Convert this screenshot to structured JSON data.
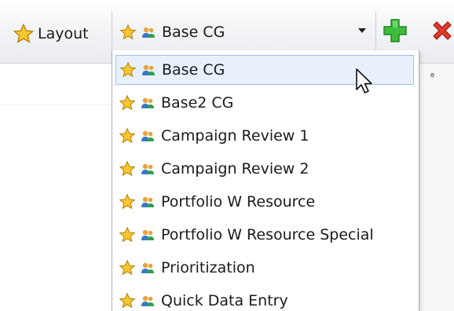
{
  "toolbar": {
    "layout_label": "Layout",
    "current_layout": "Base CG",
    "icons": {
      "layout": "star-icon",
      "add": "green-plus-icon",
      "remove": "red-x-icon"
    }
  },
  "dropdown": {
    "items": [
      {
        "label": "Base CG",
        "selected": true
      },
      {
        "label": "Base2 CG"
      },
      {
        "label": "Campaign Review 1"
      },
      {
        "label": "Campaign Review 2"
      },
      {
        "label": "Portfolio W Resource"
      },
      {
        "label": "Portfolio W Resource Special"
      },
      {
        "label": "Prioritization"
      },
      {
        "label": "Quick Data Entry"
      }
    ],
    "item_icons": [
      "star-icon",
      "users-icon"
    ]
  },
  "side_panel": {
    "pin_glyph": "ᶿ"
  },
  "colors": {
    "star_fill": "#f7c631",
    "star_stroke": "#b8860b",
    "plus_green": "#3dbb3d",
    "x_red": "#e03a2c",
    "selection_bg": "#e8f1fb",
    "selection_border": "#9cc2ea"
  }
}
